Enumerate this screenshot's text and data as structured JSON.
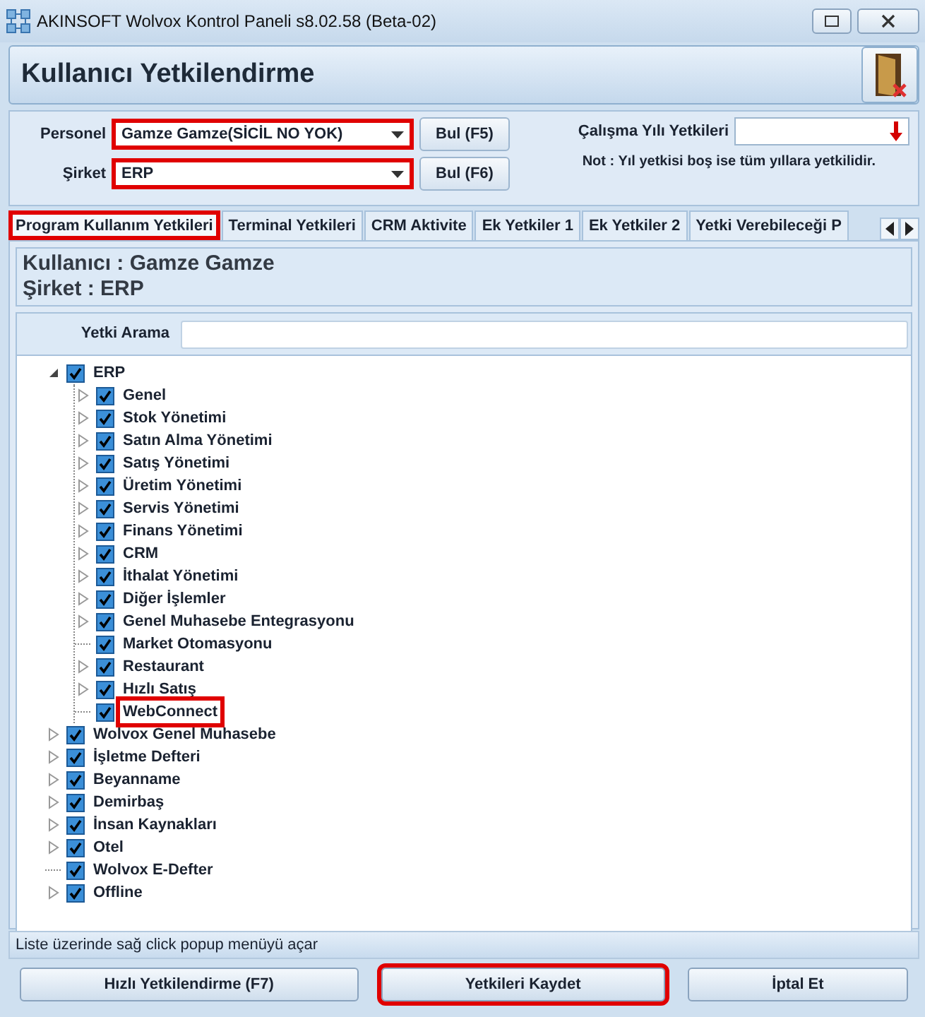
{
  "window": {
    "title": "AKINSOFT Wolvox Kontrol Paneli s8.02.58 (Beta-02)"
  },
  "header": {
    "title": "Kullanıcı Yetkilendirme"
  },
  "form": {
    "fields": [
      {
        "label": "Personel",
        "value": "Gamze Gamze(SİCİL NO YOK)",
        "highlighted": true,
        "button": "Bul (F5)"
      },
      {
        "label": "Şirket",
        "value": "ERP",
        "highlighted": true,
        "button": "Bul (F6)"
      }
    ],
    "year_label": "Çalışma Yılı Yetkileri",
    "note": "Not : Yıl yetkisi boş ise tüm yıllara yetkilidir."
  },
  "tabs": [
    {
      "label": "Program Kullanım Yetkileri",
      "selected": true,
      "highlighted": true
    },
    {
      "label": "Terminal Yetkileri",
      "selected": false,
      "highlighted": false
    },
    {
      "label": "CRM Aktivite",
      "selected": false,
      "highlighted": false
    },
    {
      "label": "Ek Yetkiler 1",
      "selected": false,
      "highlighted": false
    },
    {
      "label": "Ek Yetkiler 2",
      "selected": false,
      "highlighted": false
    },
    {
      "label": "Yetki Verebileceği P",
      "selected": false,
      "highlighted": false
    }
  ],
  "info": {
    "user": "Kullanıcı : Gamze Gamze",
    "company": "Şirket : ERP"
  },
  "search": {
    "label": "Yetki Arama"
  },
  "tree": [
    {
      "kind": "branch",
      "label": "ERP",
      "checked": true,
      "expanded": true,
      "highlighted": false,
      "children": [
        {
          "kind": "branch",
          "label": "Genel",
          "checked": true,
          "expanded": false,
          "highlighted": false
        },
        {
          "kind": "branch",
          "label": "Stok Yönetimi",
          "checked": true,
          "expanded": false,
          "highlighted": false
        },
        {
          "kind": "branch",
          "label": "Satın Alma Yönetimi",
          "checked": true,
          "expanded": false,
          "highlighted": false
        },
        {
          "kind": "branch",
          "label": "Satış Yönetimi",
          "checked": true,
          "expanded": false,
          "highlighted": false
        },
        {
          "kind": "branch",
          "label": "Üretim Yönetimi",
          "checked": true,
          "expanded": false,
          "highlighted": false
        },
        {
          "kind": "branch",
          "label": "Servis Yönetimi",
          "checked": true,
          "expanded": false,
          "highlighted": false
        },
        {
          "kind": "branch",
          "label": "Finans Yönetimi",
          "checked": true,
          "expanded": false,
          "highlighted": false
        },
        {
          "kind": "branch",
          "label": "CRM",
          "checked": true,
          "expanded": false,
          "highlighted": false
        },
        {
          "kind": "branch",
          "label": "İthalat Yönetimi",
          "checked": true,
          "expanded": false,
          "highlighted": false
        },
        {
          "kind": "branch",
          "label": "Diğer İşlemler",
          "checked": true,
          "expanded": false,
          "highlighted": false
        },
        {
          "kind": "branch",
          "label": "Genel Muhasebe Entegrasyonu",
          "checked": true,
          "expanded": false,
          "highlighted": false
        },
        {
          "kind": "leaf",
          "label": "Market Otomasyonu",
          "checked": true,
          "highlighted": false
        },
        {
          "kind": "branch",
          "label": "Restaurant",
          "checked": true,
          "expanded": false,
          "highlighted": false
        },
        {
          "kind": "branch",
          "label": "Hızlı Satış",
          "checked": true,
          "expanded": false,
          "highlighted": false
        },
        {
          "kind": "leaf",
          "label": "WebConnect",
          "checked": true,
          "highlighted": true
        }
      ]
    },
    {
      "kind": "branch",
      "label": "Wolvox Genel Muhasebe",
      "checked": true,
      "expanded": false,
      "highlighted": false
    },
    {
      "kind": "branch",
      "label": "İşletme Defteri",
      "checked": true,
      "expanded": false,
      "highlighted": false
    },
    {
      "kind": "branch",
      "label": "Beyanname",
      "checked": true,
      "expanded": false,
      "highlighted": false
    },
    {
      "kind": "branch",
      "label": "Demirbaş",
      "checked": true,
      "expanded": false,
      "highlighted": false
    },
    {
      "kind": "branch",
      "label": "İnsan Kaynakları",
      "checked": true,
      "expanded": false,
      "highlighted": false
    },
    {
      "kind": "branch",
      "label": "Otel",
      "checked": true,
      "expanded": false,
      "highlighted": false
    },
    {
      "kind": "leaf",
      "label": "Wolvox E-Defter",
      "checked": true,
      "highlighted": false
    },
    {
      "kind": "branch",
      "label": "Offline",
      "checked": true,
      "expanded": false,
      "highlighted": false
    }
  ],
  "status_bar": "Liste üzerinde sağ click popup menüyü açar",
  "buttons": [
    {
      "label": "Hızlı Yetkilendirme (F7)",
      "highlighted": false
    },
    {
      "label": "Yetkileri Kaydet",
      "highlighted": true
    },
    {
      "label": "İptal Et",
      "highlighted": false
    }
  ]
}
